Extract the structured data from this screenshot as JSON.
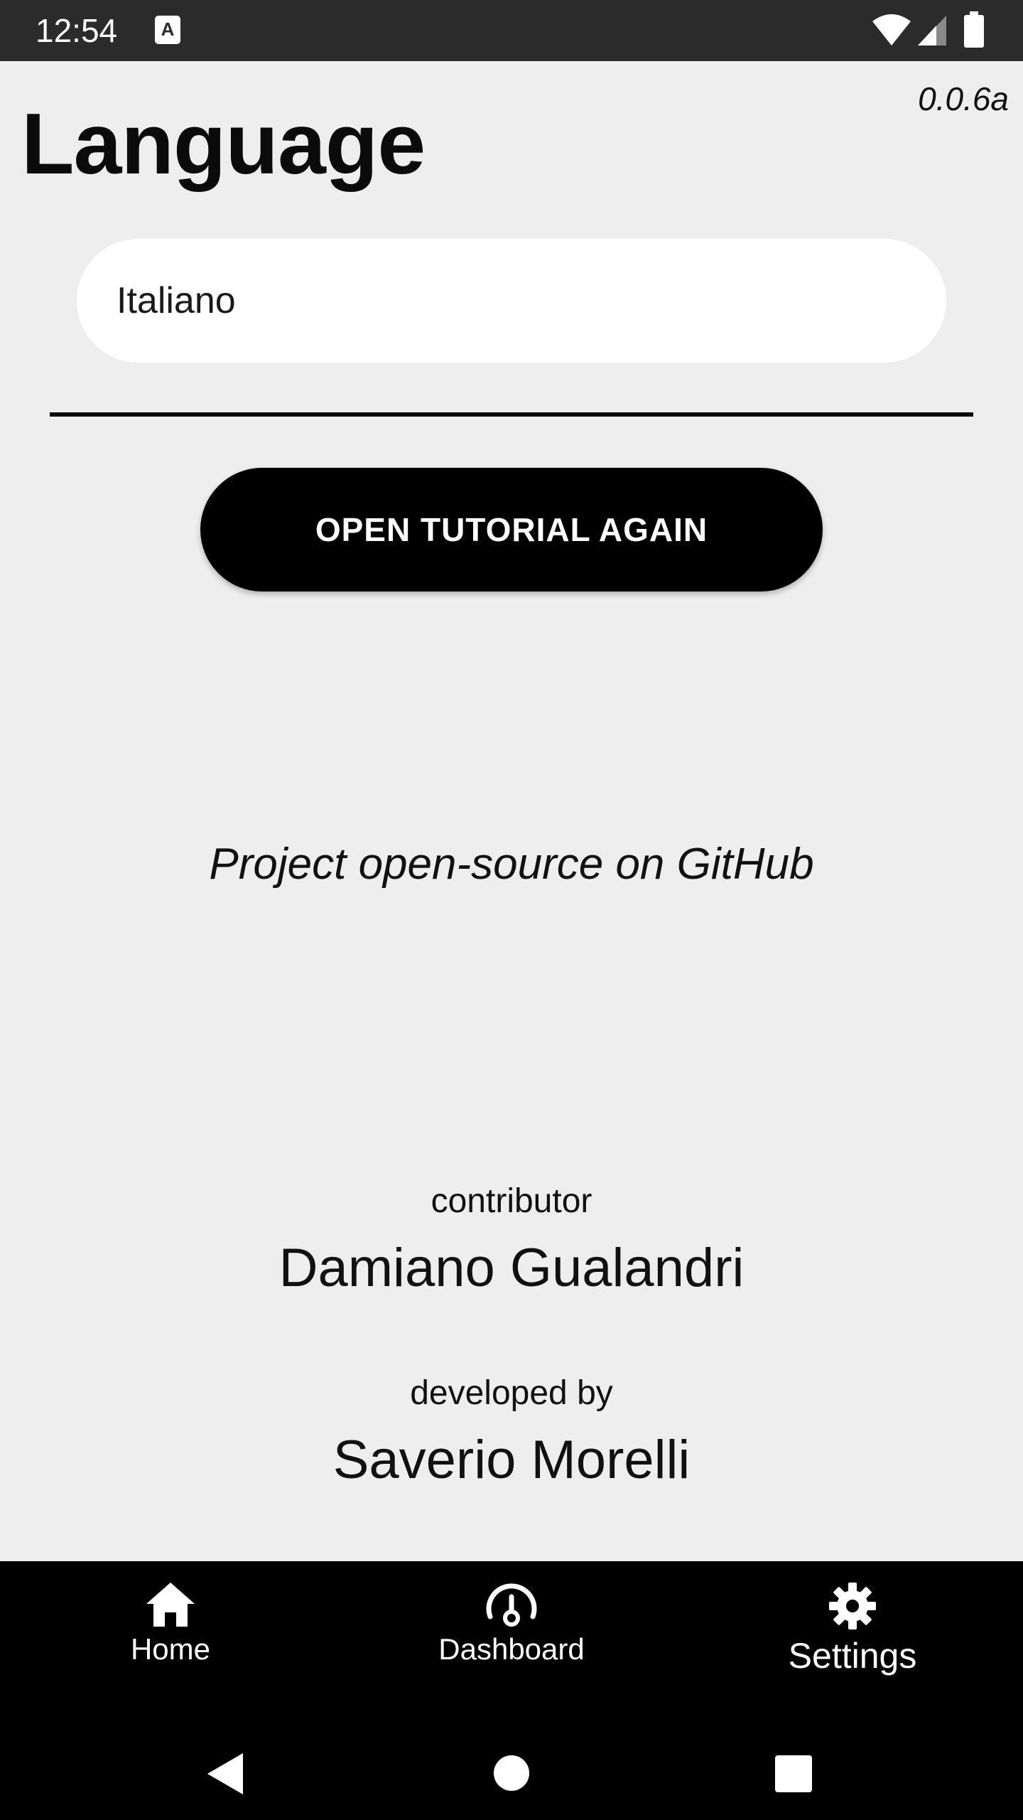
{
  "status_bar": {
    "time": "12:54",
    "notification_icon": "A",
    "icons": [
      "wifi-icon",
      "signal-icon",
      "battery-icon"
    ]
  },
  "version": "0.0.6a",
  "title": "Language",
  "language_select": {
    "value": "Italiano"
  },
  "tutorial_button": {
    "label": "OPEN TUTORIAL AGAIN"
  },
  "github_link": "Project open-source on GitHub",
  "contributor": {
    "label": "contributor",
    "name": "Damiano Gualandri"
  },
  "developer": {
    "label": "developed by",
    "name": "Saverio Morelli"
  },
  "bottom_nav": {
    "items": [
      {
        "label": "Home",
        "icon": "home-icon"
      },
      {
        "label": "Dashboard",
        "icon": "dashboard-icon"
      },
      {
        "label": "Settings",
        "icon": "gear-icon",
        "selected": true
      }
    ]
  },
  "system_nav": {
    "icons": [
      "back-icon",
      "home-circle-icon",
      "recents-icon"
    ]
  },
  "colors": {
    "background": "#eeeeee",
    "status_bar": "#2b2b2b",
    "nav_bar": "#000000",
    "button": "#000000",
    "select_bg": "#ffffff"
  }
}
